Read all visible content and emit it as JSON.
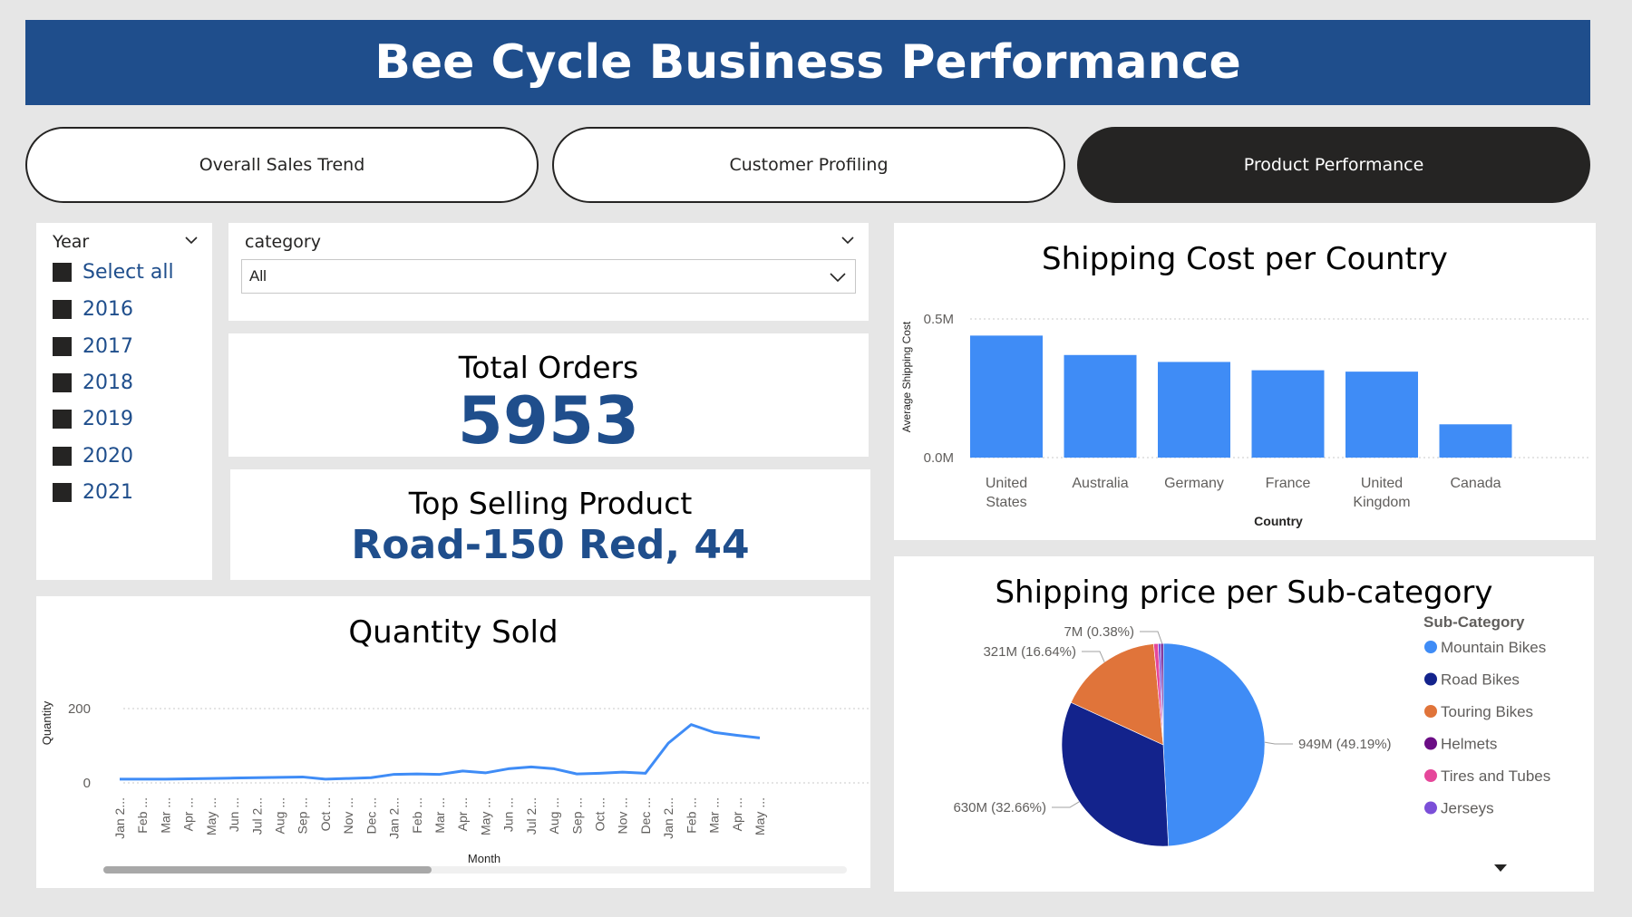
{
  "header": {
    "title": "Bee Cycle Business Performance"
  },
  "nav": {
    "tabs": [
      {
        "label": "Overall Sales Trend",
        "active": false
      },
      {
        "label": "Customer Profiling",
        "active": false
      },
      {
        "label": "Product Performance",
        "active": true
      }
    ]
  },
  "year_slicer": {
    "title": "Year",
    "items": [
      "Select all",
      "2016",
      "2017",
      "2018",
      "2019",
      "2020",
      "2021"
    ]
  },
  "category_slicer": {
    "title": "category",
    "selected": "All"
  },
  "kpis": {
    "total_orders_label": "Total Orders",
    "total_orders_value": "5953",
    "top_product_label": "Top Selling Product",
    "top_product_value": "Road-150 Red, 44"
  },
  "colors": {
    "banner": "#1f4e8c",
    "accent": "#1f4e8c",
    "bar": "#3f8cf6",
    "nav_active": "#252423"
  },
  "chart_data": [
    {
      "type": "line",
      "title": "Quantity Sold",
      "xlabel": "Month",
      "ylabel": "Quantity",
      "ylim": [
        0,
        200
      ],
      "yticks": [
        "0",
        "200"
      ],
      "x": [
        "Jan 2...",
        "Feb ...",
        "Mar ...",
        "Apr ...",
        "May ...",
        "Jun ...",
        "Jul 2...",
        "Aug ...",
        "Sep ...",
        "Oct ...",
        "Nov ...",
        "Dec ...",
        "Jan 2...",
        "Feb ...",
        "Mar ...",
        "Apr ...",
        "May ...",
        "Jun ...",
        "Jul 2...",
        "Aug ...",
        "Sep ...",
        "Oct ...",
        "Nov ...",
        "Dec ...",
        "Jan 2...",
        "Feb ...",
        "Mar ...",
        "Apr ...",
        "May ..."
      ],
      "values": [
        10,
        10,
        10,
        11,
        12,
        13,
        14,
        15,
        16,
        10,
        12,
        14,
        23,
        24,
        23,
        32,
        27,
        38,
        43,
        38,
        24,
        26,
        29,
        26,
        107,
        157,
        136,
        128,
        121
      ],
      "grid": true,
      "color": "#3f8cf6"
    },
    {
      "type": "bar",
      "title": "Shipping Cost per Country",
      "xlabel": "Country",
      "ylabel": "Average Shipping Cost",
      "categories": [
        "United States",
        "Australia",
        "Germany",
        "France",
        "United Kingdom",
        "Canada"
      ],
      "values": [
        0.44,
        0.37,
        0.345,
        0.315,
        0.31,
        0.12
      ],
      "ylim": [
        0,
        0.5
      ],
      "yticks": [
        "0.0M",
        "0.5M"
      ],
      "grid": true,
      "color": "#3f8cf6"
    },
    {
      "type": "pie",
      "title": "Shipping price per Sub-category",
      "legend_title": "Sub-Category",
      "legend_position": "right",
      "slices": [
        {
          "name": "Mountain Bikes",
          "value": 49.19,
          "label": "949M (49.19%)",
          "color": "#3f8cf6"
        },
        {
          "name": "Road Bikes",
          "value": 32.66,
          "label": "630M (32.66%)",
          "color": "#13238c"
        },
        {
          "name": "Touring Bikes",
          "value": 16.64,
          "label": "321M (16.64%)",
          "color": "#e0743a"
        },
        {
          "name": "Helmets",
          "value": 0.38,
          "label": "7M (0.38%)",
          "color": "#6b0d85"
        },
        {
          "name": "Tires and Tubes",
          "value": 0.7,
          "label": "",
          "color": "#e5479a"
        },
        {
          "name": "Jerseys",
          "value": 0.43,
          "label": "",
          "color": "#7b4fd8"
        }
      ]
    }
  ]
}
